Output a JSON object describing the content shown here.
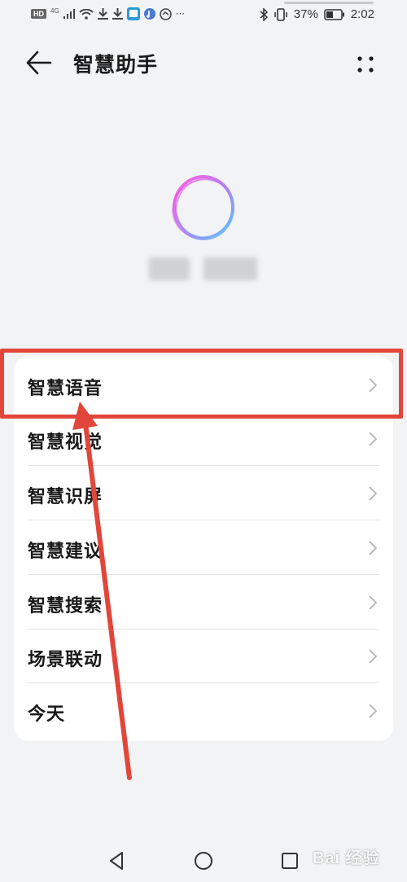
{
  "status_bar": {
    "hd": "HD",
    "network": "4G",
    "more": "···",
    "battery_percent": "37%",
    "time": "2:02"
  },
  "header": {
    "title": "智慧助手"
  },
  "menu": {
    "items": [
      {
        "label": "智慧语音",
        "highlighted": true
      },
      {
        "label": "智慧视觉"
      },
      {
        "label": "智慧识屏"
      },
      {
        "label": "智慧建议"
      },
      {
        "label": "智慧搜索"
      },
      {
        "label": "场景联动"
      },
      {
        "label": "今天"
      }
    ]
  },
  "annotation": {
    "color": "#e2463a"
  },
  "watermark": "Bai 经验"
}
